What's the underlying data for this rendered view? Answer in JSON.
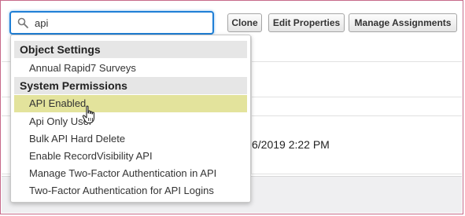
{
  "search": {
    "value": "api"
  },
  "toolbar": {
    "clone_label": "Clone",
    "edit_label": "Edit Properties",
    "manage_label": "Manage Assignments"
  },
  "background": {
    "datetime": "6/2019 2:22 PM"
  },
  "dropdown": {
    "groups": [
      {
        "label": "Object Settings",
        "items": [
          "Annual Rapid7 Surveys"
        ]
      },
      {
        "label": "System Permissions",
        "items": [
          "API Enabled",
          "Api Only User",
          "Bulk API Hard Delete",
          "Enable RecordVisibility API",
          "Manage Two-Factor Authentication in API",
          "Two-Factor Authentication for API Logins"
        ]
      }
    ],
    "highlighted_item": "API Enabled"
  },
  "colors": {
    "focus_border": "#1f7fd6",
    "highlight": "#e3e39c",
    "frame_border": "#c66a8a",
    "group_header_bg": "#e6e6e6"
  },
  "icons": {
    "search": "search-icon",
    "cursor": "hand-pointer-cursor-icon"
  }
}
